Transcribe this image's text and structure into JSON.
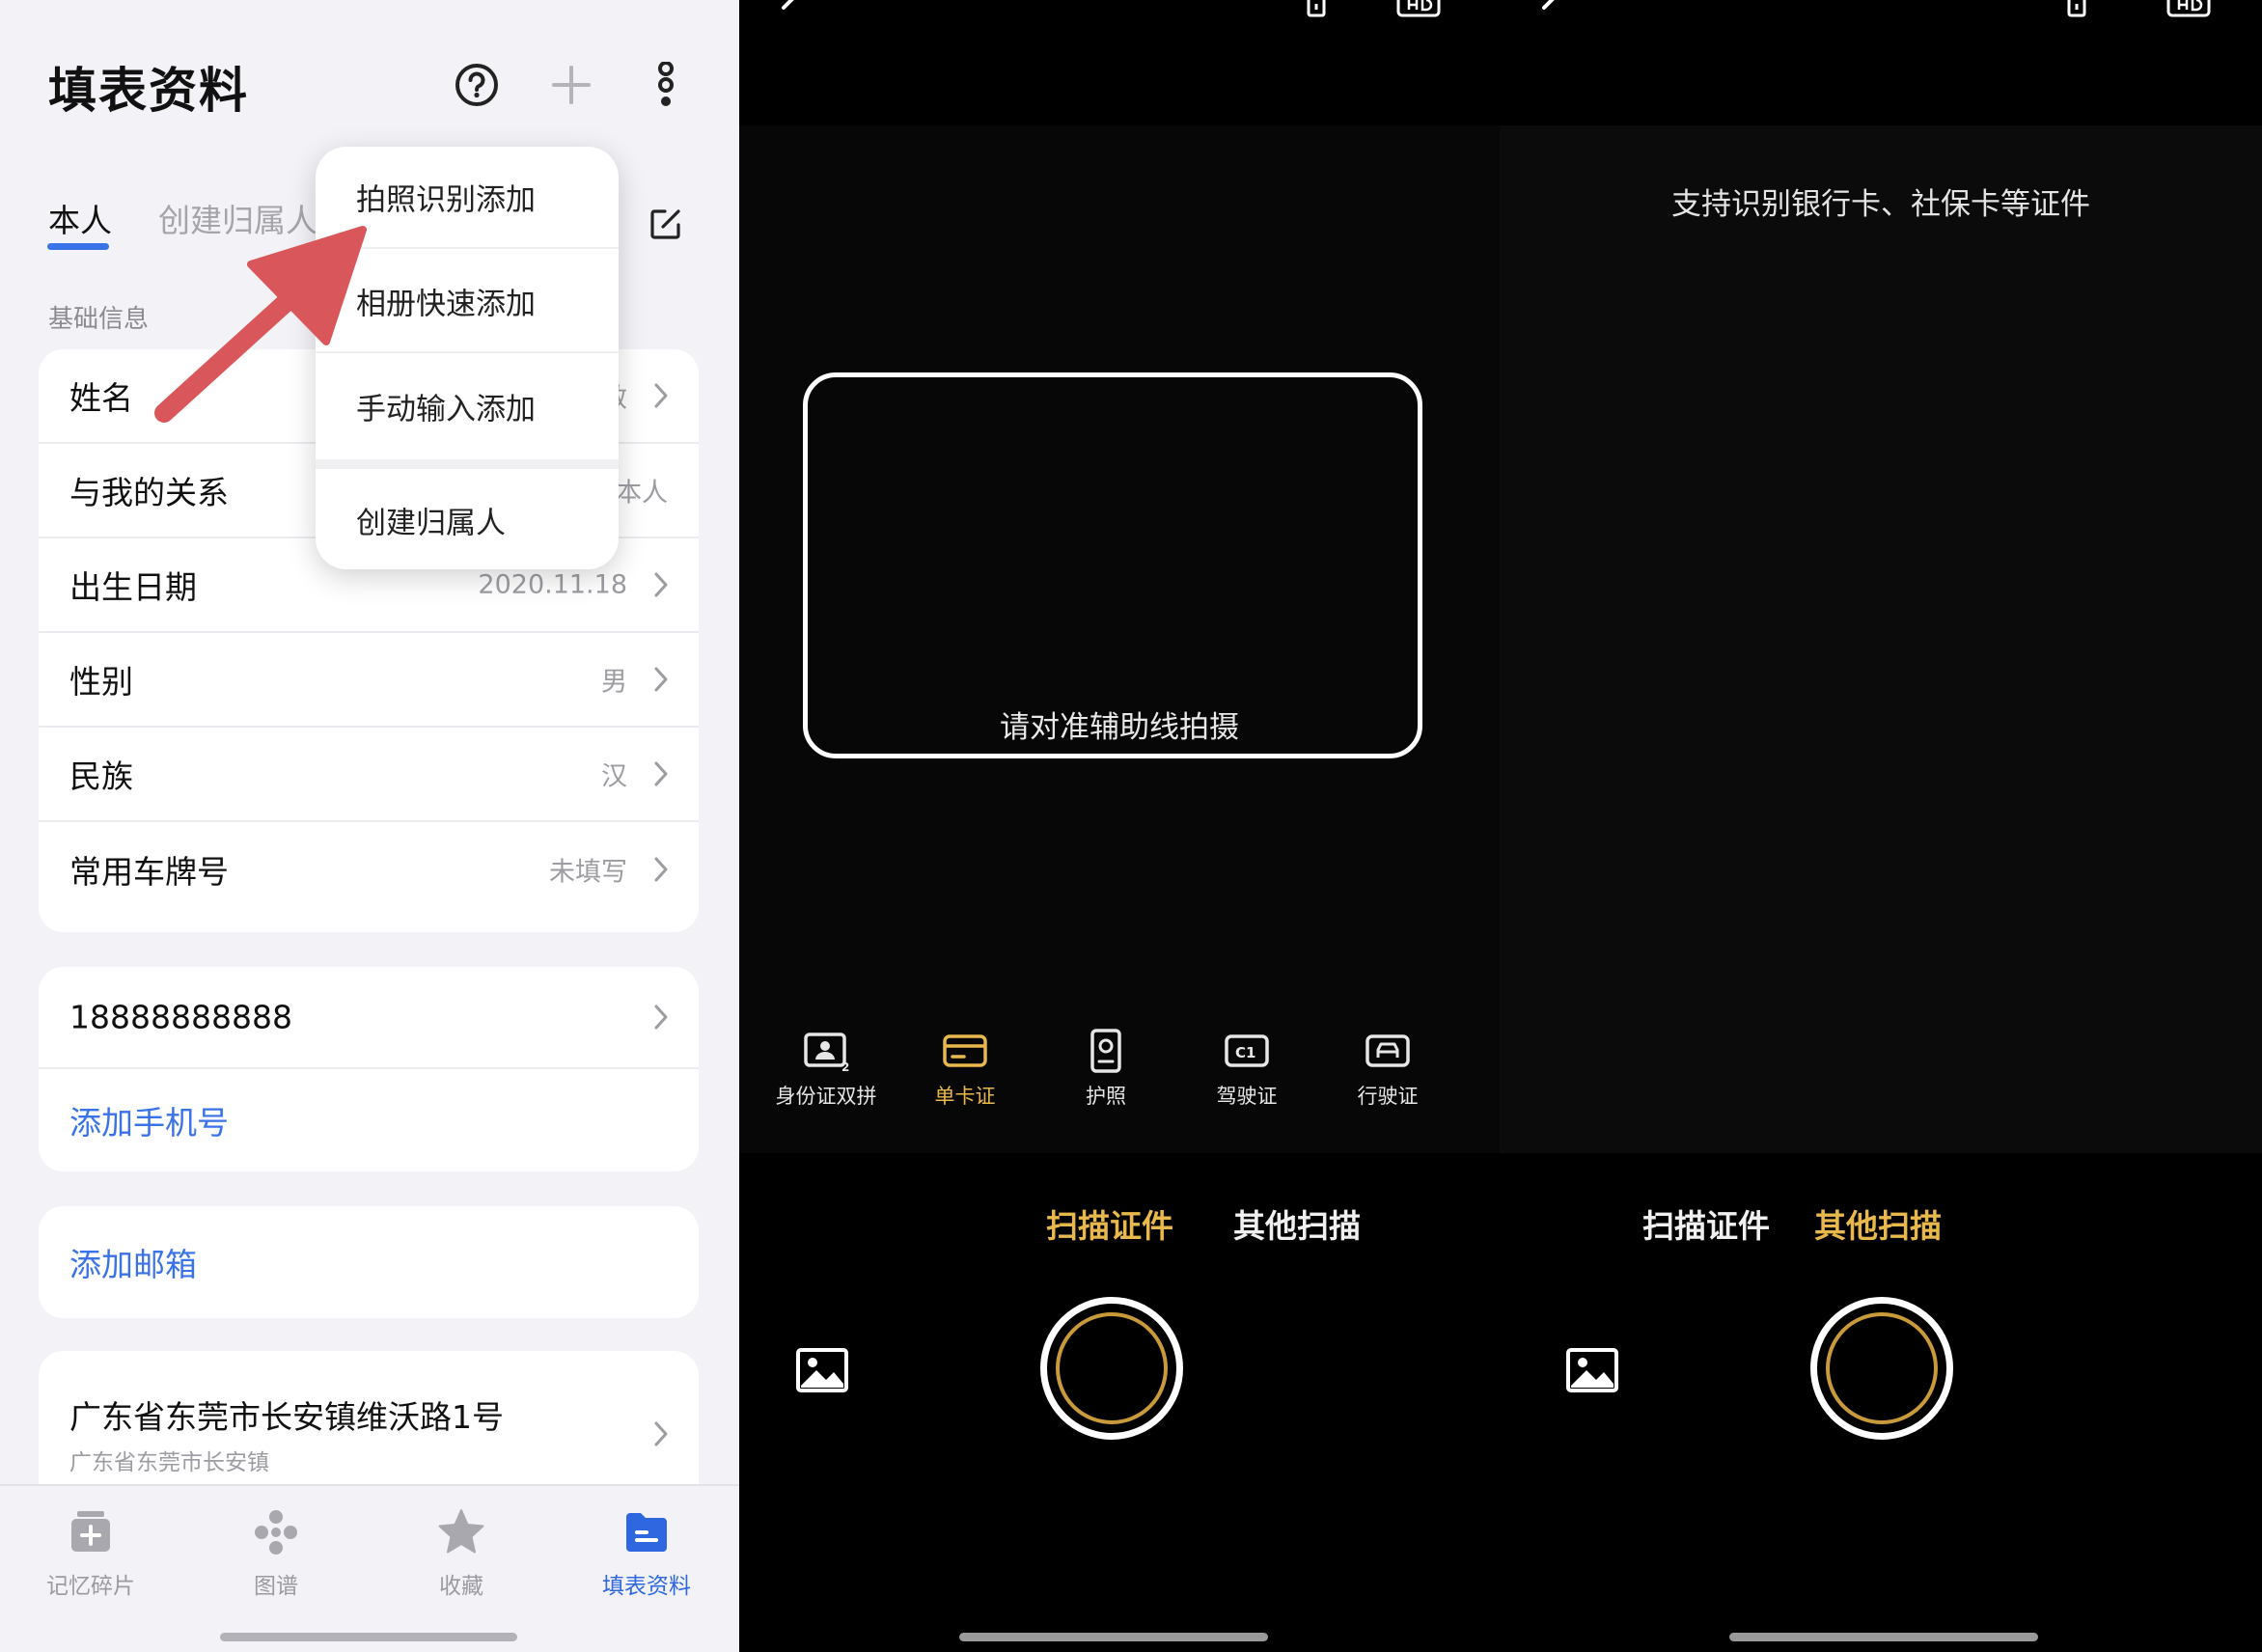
{
  "left": {
    "title": "填表资料",
    "tabs": [
      {
        "label": "本人",
        "active": true
      },
      {
        "label": "创建归属人",
        "active": false
      }
    ],
    "section_label": "基础信息",
    "basic_rows": [
      {
        "label": "姓名",
        "value": "敏"
      },
      {
        "label": "与我的关系",
        "value": "本人"
      },
      {
        "label": "出生日期",
        "value": "2020.11.18"
      },
      {
        "label": "性别",
        "value": "男"
      },
      {
        "label": "民族",
        "value": "汉"
      },
      {
        "label": "常用车牌号",
        "value": "未填写"
      }
    ],
    "phone": "18888888888",
    "add_phone": "添加手机号",
    "add_email": "添加邮箱",
    "address_main": "广东省东莞市长安镇维沃路1号",
    "address_sub": "广东省东莞市长安镇",
    "dropdown": [
      "拍照识别添加",
      "相册快速添加",
      "手动输入添加",
      "创建归属人"
    ],
    "tabbar": [
      {
        "label": "记忆碎片",
        "active": false
      },
      {
        "label": "图谱",
        "active": false
      },
      {
        "label": "收藏",
        "active": false
      },
      {
        "label": "填表资料",
        "active": true
      }
    ]
  },
  "mid": {
    "guide_text": "请对准辅助线拍摄",
    "doc_types": [
      {
        "label": "身份证双拼",
        "active": false
      },
      {
        "label": "单卡证",
        "active": true
      },
      {
        "label": "护照",
        "active": false
      },
      {
        "label": "驾驶证",
        "active": false
      },
      {
        "label": "行驶证",
        "active": false
      }
    ],
    "modes": [
      {
        "label": "扫描证件",
        "active": true
      },
      {
        "label": "其他扫描",
        "active": false
      }
    ]
  },
  "right": {
    "hint_text": "支持识别银行卡、社保卡等证件",
    "modes": [
      {
        "label": "扫描证件",
        "active": false
      },
      {
        "label": "其他扫描",
        "active": true
      }
    ]
  },
  "colors": {
    "accent_blue": "#3a72e8",
    "camera_gold": "#e8b84d",
    "arrow_red": "#d9575a"
  },
  "icons": [
    "help-icon",
    "plus-icon",
    "more-vertical-icon",
    "edit-icon",
    "chevron-right-icon",
    "back-icon",
    "flash-icon",
    "hd-icon",
    "gallery-icon"
  ]
}
